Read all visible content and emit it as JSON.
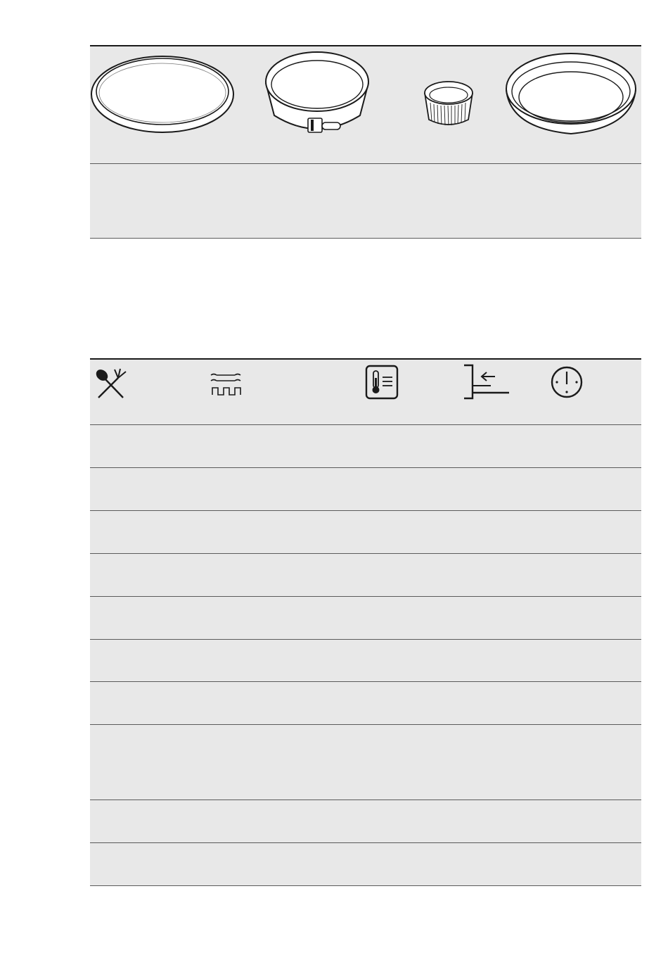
{
  "top_table": {
    "images": [
      {
        "icon": "baking-tray-icon"
      },
      {
        "icon": "springform-pan-icon"
      },
      {
        "icon": "ramekin-icon"
      },
      {
        "icon": "flan-dish-icon"
      }
    ],
    "caption_row": [
      "",
      "",
      "",
      ""
    ]
  },
  "bottom_table": {
    "header_icons": [
      {
        "icon": "food-category-icon"
      },
      {
        "icon": "oven-function-icon"
      },
      {
        "icon": "temperature-icon"
      },
      {
        "icon": "shelf-position-icon"
      },
      {
        "icon": "time-icon"
      }
    ],
    "rows": [
      {
        "cells": [
          "",
          "",
          "",
          "",
          ""
        ]
      },
      {
        "cells": [
          "",
          "",
          "",
          "",
          ""
        ]
      },
      {
        "cells": [
          "",
          "",
          "",
          "",
          ""
        ]
      },
      {
        "cells": [
          "",
          "",
          "",
          "",
          ""
        ]
      },
      {
        "cells": [
          "",
          "",
          "",
          "",
          ""
        ]
      },
      {
        "cells": [
          "",
          "",
          "",
          "",
          ""
        ]
      },
      {
        "cells": [
          "",
          "",
          "",
          "",
          ""
        ]
      },
      {
        "cells": [
          "",
          "",
          "",
          "",
          ""
        ]
      },
      {
        "cells": [
          "",
          "",
          "",
          "",
          ""
        ]
      },
      {
        "cells": [
          "",
          "",
          "",
          "",
          ""
        ]
      }
    ]
  },
  "colors": {
    "table_fill": "#e8e8e8",
    "rule": "#1a1a1a",
    "icon_stroke": "#1a1a1a"
  }
}
